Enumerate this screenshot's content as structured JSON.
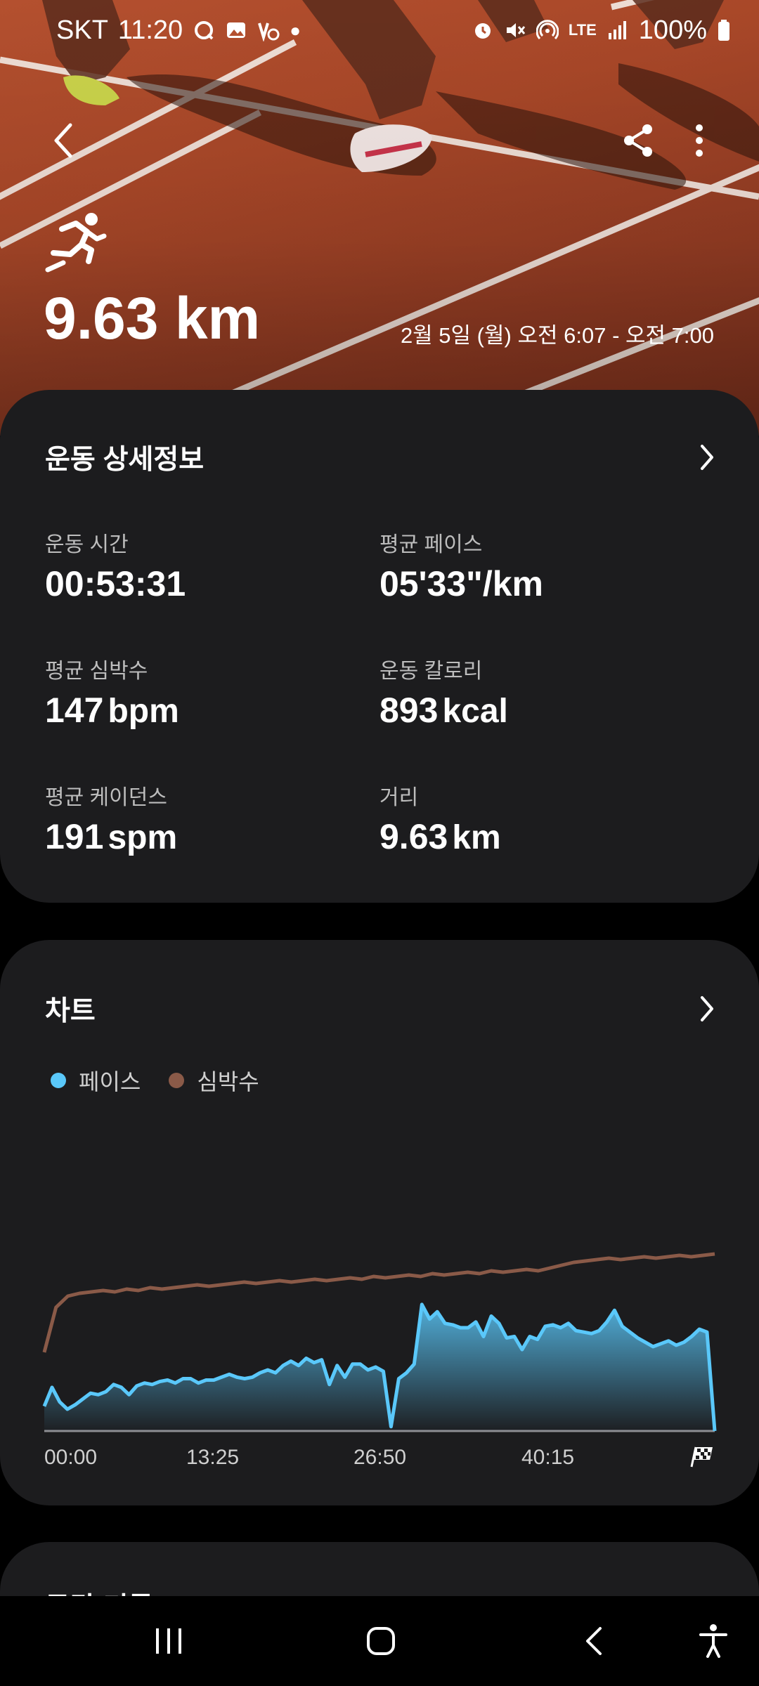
{
  "status_bar": {
    "carrier": "SKT",
    "time": "11:20",
    "battery": "100%",
    "network": "LTE"
  },
  "hero": {
    "distance": "9.63 km",
    "datetime": "2월 5일 (월) 오전 6:07 - 오전 7:00"
  },
  "details": {
    "title": "운동 상세정보",
    "stats": [
      {
        "label": "운동 시간",
        "value": "00:53:31",
        "unit": ""
      },
      {
        "label": "평균 페이스",
        "value": "05'33\"/km",
        "unit": ""
      },
      {
        "label": "평균 심박수",
        "value": "147",
        "unit": "bpm"
      },
      {
        "label": "운동 칼로리",
        "value": "893",
        "unit": "kcal"
      },
      {
        "label": "평균 케이던스",
        "value": "191",
        "unit": "spm"
      },
      {
        "label": "거리",
        "value": "9.63",
        "unit": "km"
      }
    ]
  },
  "chart_card": {
    "title": "차트",
    "legend": [
      {
        "name": "페이스",
        "color": "#5ac8fa"
      },
      {
        "name": "심박수",
        "color": "#8a5a48"
      }
    ]
  },
  "chart_data": {
    "type": "area",
    "x": [
      "00:00",
      "13:25",
      "26:50",
      "40:15"
    ],
    "series": [
      {
        "name": "페이스",
        "values": [
          0.17,
          0.3,
          0.2,
          0.15,
          0.18,
          0.22,
          0.26,
          0.25,
          0.27,
          0.32,
          0.3,
          0.25,
          0.31,
          0.33,
          0.32,
          0.34,
          0.35,
          0.33,
          0.36,
          0.36,
          0.33,
          0.35,
          0.35,
          0.37,
          0.39,
          0.37,
          0.36,
          0.37,
          0.4,
          0.42,
          0.4,
          0.45,
          0.48,
          0.45,
          0.5,
          0.47,
          0.49,
          0.32,
          0.45,
          0.37,
          0.46,
          0.46,
          0.42,
          0.44,
          0.41,
          0.03,
          0.36,
          0.4,
          0.46,
          0.87,
          0.77,
          0.82,
          0.74,
          0.73,
          0.71,
          0.71,
          0.75,
          0.65,
          0.79,
          0.74,
          0.64,
          0.65,
          0.56,
          0.65,
          0.63,
          0.72,
          0.73,
          0.71,
          0.74,
          0.69,
          0.68,
          0.67,
          0.69,
          0.75,
          0.83,
          0.72,
          0.68,
          0.64,
          0.61,
          0.58,
          0.6,
          0.62,
          0.59,
          0.61,
          0.65,
          0.7,
          0.68,
          0.0
        ]
      },
      {
        "name": "심박수",
        "values": [
          0.3,
          0.62,
          0.7,
          0.72,
          0.73,
          0.74,
          0.73,
          0.75,
          0.74,
          0.76,
          0.75,
          0.76,
          0.77,
          0.78,
          0.77,
          0.78,
          0.79,
          0.8,
          0.79,
          0.8,
          0.81,
          0.8,
          0.81,
          0.82,
          0.81,
          0.82,
          0.83,
          0.82,
          0.84,
          0.83,
          0.84,
          0.85,
          0.84,
          0.86,
          0.85,
          0.86,
          0.87,
          0.86,
          0.88,
          0.87,
          0.88,
          0.89,
          0.88,
          0.9,
          0.92,
          0.94,
          0.95,
          0.96,
          0.97,
          0.96,
          0.97,
          0.98,
          0.97,
          0.98,
          0.99,
          0.98,
          0.99,
          1.0
        ]
      }
    ],
    "xlabel": "",
    "ylabel": "",
    "grid": false
  },
  "next_card": {
    "title": "구간 기록"
  },
  "nav": {
    "recents": "recents",
    "home": "home",
    "back": "back",
    "accessibility": "accessibility"
  }
}
